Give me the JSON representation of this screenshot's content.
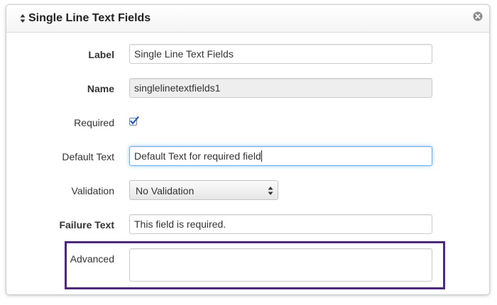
{
  "panel": {
    "title": "Single Line Text Fields",
    "sort_icon": "sort-updown-icon",
    "close_icon": "circle-close-icon"
  },
  "fields": {
    "label": {
      "label": "Label",
      "value": "Single Line Text Fields"
    },
    "name": {
      "label": "Name",
      "value": "singlelinetextfields1"
    },
    "required": {
      "label": "Required",
      "checked": true
    },
    "default_text": {
      "label": "Default Text",
      "value": "Default Text for required field"
    },
    "validation": {
      "label": "Validation",
      "selected": "No Validation"
    },
    "failure_text": {
      "label": "Failure Text",
      "value": "This field is required."
    },
    "advanced": {
      "label": "Advanced",
      "value": ""
    }
  },
  "colors": {
    "highlight_border": "#4b2a7b",
    "focus_border": "#66afe9",
    "checkmark": "#2a5aa8"
  }
}
